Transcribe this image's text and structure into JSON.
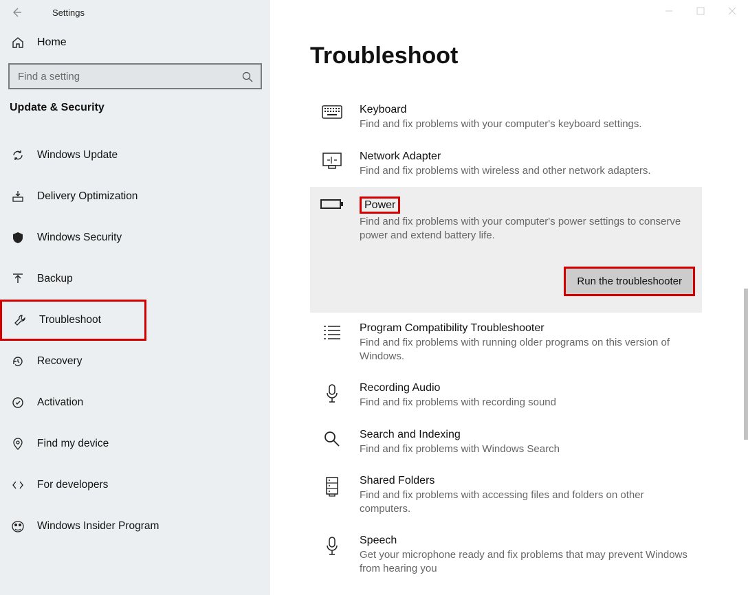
{
  "app_title": "Settings",
  "home_label": "Home",
  "search_placeholder": "Find a setting",
  "section_title": "Update & Security",
  "nav": [
    {
      "label": "Windows Update"
    },
    {
      "label": "Delivery Optimization"
    },
    {
      "label": "Windows Security"
    },
    {
      "label": "Backup"
    },
    {
      "label": "Troubleshoot"
    },
    {
      "label": "Recovery"
    },
    {
      "label": "Activation"
    },
    {
      "label": "Find my device"
    },
    {
      "label": "For developers"
    },
    {
      "label": "Windows Insider Program"
    }
  ],
  "page_title": "Troubleshoot",
  "run_button_label": "Run the troubleshooter",
  "troubleshooters": [
    {
      "name": "Keyboard",
      "desc": "Find and fix problems with your computer's keyboard settings."
    },
    {
      "name": "Network Adapter",
      "desc": "Find and fix problems with wireless and other network adapters."
    },
    {
      "name": "Power",
      "desc": "Find and fix problems with your computer's power settings to conserve power and extend battery life."
    },
    {
      "name": "Program Compatibility Troubleshooter",
      "desc": "Find and fix problems with running older programs on this version of Windows."
    },
    {
      "name": "Recording Audio",
      "desc": "Find and fix problems with recording sound"
    },
    {
      "name": "Search and Indexing",
      "desc": "Find and fix problems with Windows Search"
    },
    {
      "name": "Shared Folders",
      "desc": "Find and fix problems with accessing files and folders on other computers."
    },
    {
      "name": "Speech",
      "desc": "Get your microphone ready and fix problems that may prevent Windows from hearing you"
    }
  ]
}
